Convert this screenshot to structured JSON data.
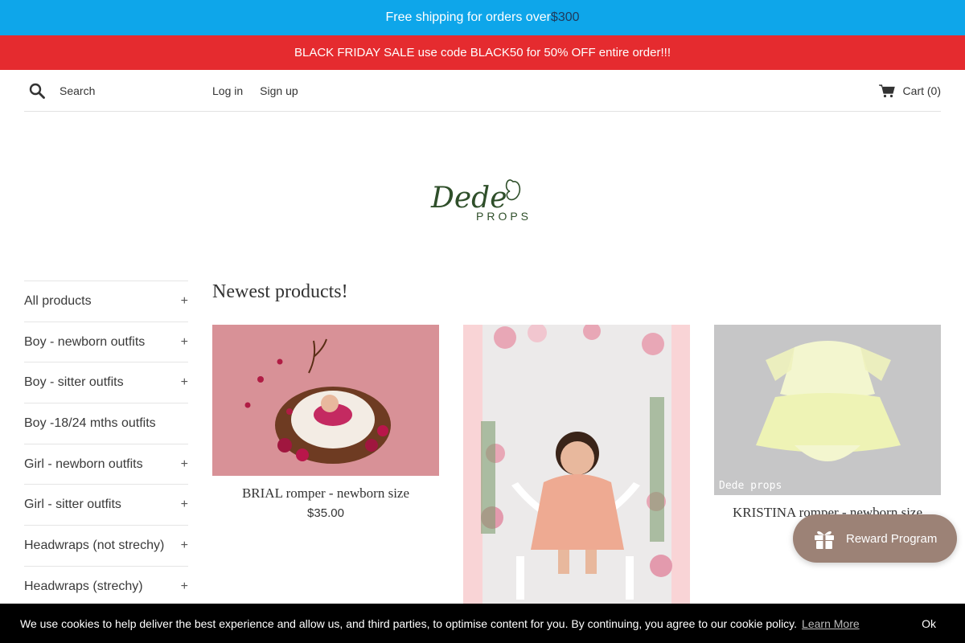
{
  "top_bar": {
    "text": "Free shipping for orders over ",
    "amount": "$300"
  },
  "sale_bar": {
    "text": "BLACK FRIDAY SALE use code BLACK50 for 50% OFF entire order!!!"
  },
  "header": {
    "search_placeholder": "Search",
    "login_label": "Log in",
    "signup_label": "Sign up",
    "cart_label": "Cart (0)"
  },
  "logo": {
    "script_text": "Dede",
    "sub_text": "PROPS"
  },
  "sidebar": {
    "items": [
      {
        "label": "All products",
        "expandable": "+"
      },
      {
        "label": "Boy - newborn outfits",
        "expandable": "+"
      },
      {
        "label": "Boy - sitter outfits",
        "expandable": "+"
      },
      {
        "label": "Boy -18/24 mths outfits",
        "expandable": ""
      },
      {
        "label": "Girl - newborn outfits",
        "expandable": "+"
      },
      {
        "label": "Girl - sitter outfits",
        "expandable": "+"
      },
      {
        "label": "Headwraps (not strechy)",
        "expandable": "+"
      },
      {
        "label": "Headwraps (strechy)",
        "expandable": "+"
      }
    ]
  },
  "main": {
    "title": "Newest products!",
    "products": [
      {
        "name": "BRIAL romper - newborn size",
        "price": "$35.00",
        "watermark": ""
      },
      {
        "name": "",
        "price": "",
        "watermark": ""
      },
      {
        "name": "KRISTINA romper - newborn size",
        "price": "",
        "watermark": "Dede props"
      }
    ]
  },
  "reward": {
    "label": "Reward Program"
  },
  "cookie": {
    "text": "We use cookies to help deliver the best experience and allow us, and third parties, to optimise content for you. By continuing, you agree to our cookie policy.",
    "learn_more": "Learn More",
    "ok": "Ok"
  },
  "colors": {
    "top_bar_bg": "#0ea6ea",
    "sale_bar_bg": "#e52b2f",
    "reward_bg": "#9c8276",
    "logo_green": "#2f4f2a"
  }
}
